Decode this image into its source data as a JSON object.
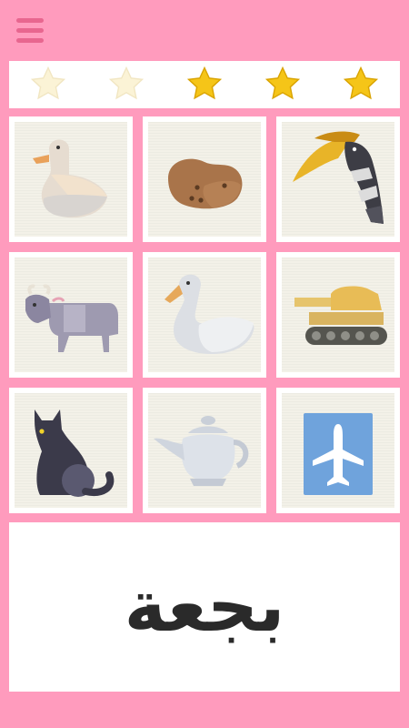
{
  "menu": {
    "icon": "hamburger-menu-icon"
  },
  "rating": {
    "total": 5,
    "earned": 3,
    "stars": [
      {
        "icon": "star-empty-icon",
        "filled": false
      },
      {
        "icon": "star-empty-icon",
        "filled": false
      },
      {
        "icon": "star-filled-icon",
        "filled": true
      },
      {
        "icon": "star-filled-icon",
        "filled": true
      },
      {
        "icon": "star-filled-icon",
        "filled": true
      }
    ]
  },
  "choices": [
    {
      "icon": "duck-icon"
    },
    {
      "icon": "potato-icon"
    },
    {
      "icon": "hornbill-icon"
    },
    {
      "icon": "ox-icon"
    },
    {
      "icon": "swan-icon"
    },
    {
      "icon": "tank-icon"
    },
    {
      "icon": "cat-icon"
    },
    {
      "icon": "teapot-icon"
    },
    {
      "icon": "airplane-icon"
    }
  ],
  "question": {
    "word": "بجعة"
  },
  "colors": {
    "background": "#ff9bbd",
    "menu": "#e8668f",
    "star_filled": "#f5c518",
    "star_empty": "#fbf3d6"
  }
}
